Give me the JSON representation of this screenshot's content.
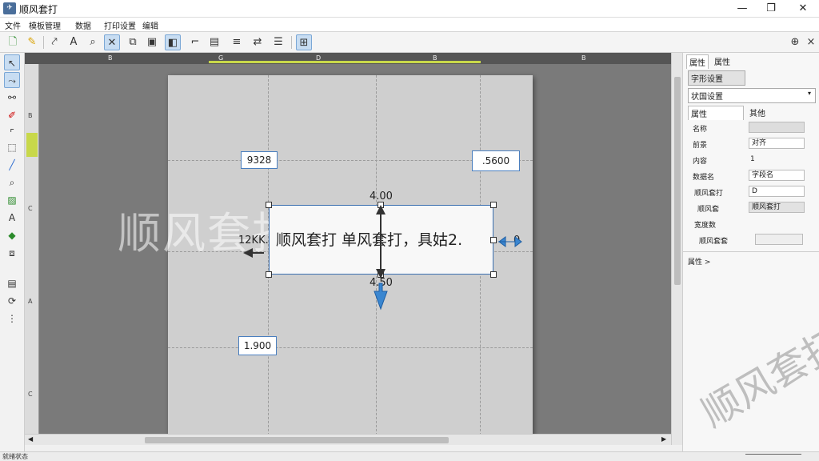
{
  "window": {
    "title": "顺风套打",
    "minimize": "—",
    "maximize": "❐",
    "close": "✕"
  },
  "menu": [
    {
      "label": "文件"
    },
    {
      "label": "模板管理"
    },
    {
      "label": "数据"
    },
    {
      "label": "打印设置"
    },
    {
      "label": "编辑"
    }
  ],
  "toolbar": {
    "icons": [
      "new-file-icon",
      "open-folder-icon",
      "pointer-icon",
      "text-tool-icon",
      "zoom-tool-icon",
      "delete-icon",
      "copy-icon",
      "paste-icon",
      "align-icon",
      "crop-icon",
      "table-icon",
      "lines-icon",
      "bring-forward-icon",
      "grid-icon",
      "snap-icon"
    ],
    "pin": "⊕",
    "close": "×"
  },
  "rulers": {
    "horizontal": [
      "B",
      "G",
      "D",
      "B",
      "B"
    ],
    "vertical": [
      "B",
      "C",
      "A",
      "C"
    ]
  },
  "canvas": {
    "watermark": "顺风套打",
    "main_field": {
      "text": "顺风套打  单风套打，具姑2.",
      "left_label": "12KK.",
      "top_dim": "4.00",
      "bottom_dim": "4.50",
      "right_label": "0"
    },
    "field_top_left": "9328",
    "field_top_right": ".5600",
    "field_bottom_left": "1.900"
  },
  "right_panel": {
    "tabs": [
      "属性",
      "属性"
    ],
    "button": "字形设置",
    "select": "状国设置",
    "subtabs": [
      "属性",
      "其他"
    ],
    "rows": [
      {
        "label": "名称",
        "value": ""
      },
      {
        "label": "前景",
        "value": "对齐"
      },
      {
        "label": "内容",
        "value": "1"
      },
      {
        "label": "数据名",
        "value": "字段名"
      },
      {
        "label": "顺风套打",
        "value": "D"
      },
      {
        "label": "顺风套",
        "value": "顺风套打"
      },
      {
        "label": "宽度数",
        "value": ""
      },
      {
        "label": "顺风套套",
        "value": ""
      }
    ],
    "section_label": "属性 >"
  },
  "statusbar": {
    "text": "就绪状态"
  },
  "watermark_corner": "顺风套打"
}
